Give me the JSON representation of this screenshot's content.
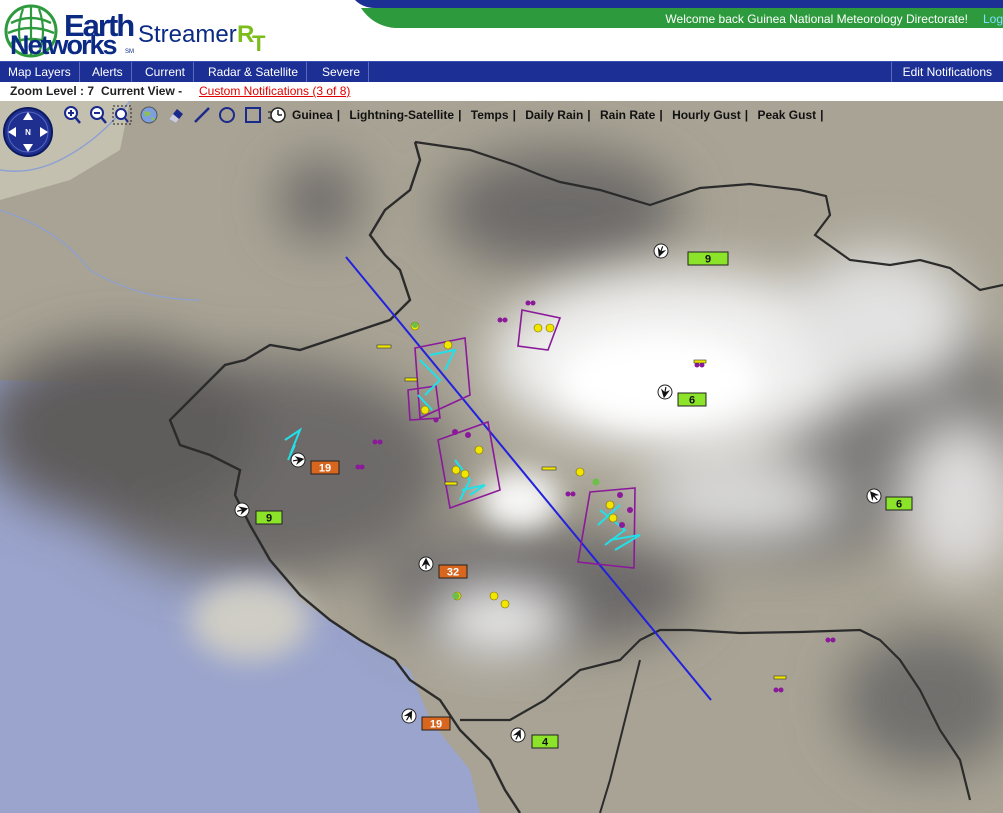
{
  "header": {
    "brand_line1": "Earth",
    "brand_line2": "Networks",
    "brand_mark": "SM",
    "product_name": "Streamer",
    "product_r": "R",
    "product_t": "T",
    "welcome_text": "Welcome back  Guinea National Meteorology Directorate!",
    "welcome_link": "Log"
  },
  "nav": {
    "items": [
      "Map Layers",
      "Alerts",
      "Current",
      "Radar & Satellite",
      "Severe"
    ],
    "right_item": "Edit Notifications"
  },
  "status": {
    "zoom_label": "Zoom Level : 7",
    "view_label": "Current View -",
    "notifications_link": "Custom Notifications (3 of 8)"
  },
  "toolbar": {
    "icons": [
      "zoom-in-icon",
      "zoom-out-icon",
      "zoom-box-icon",
      "globe-icon",
      "eraser-icon",
      "line-draw-icon",
      "circle-draw-icon",
      "square-draw-icon",
      "clock-icon"
    ]
  },
  "layers": [
    "Guinea",
    "Lightning-Satellite",
    "Temps",
    "Daily Rain",
    "Rain Rate",
    "Hourly Gust",
    "Peak Gust"
  ],
  "wind_stations": [
    {
      "value": "9",
      "color": "#8be32a"
    },
    {
      "value": "6",
      "color": "#8be32a"
    },
    {
      "value": "19",
      "color": "#d9661f"
    },
    {
      "value": "9",
      "color": "#8be32a"
    },
    {
      "value": "6",
      "color": "#8be32a"
    },
    {
      "value": "32",
      "color": "#d9661f"
    },
    {
      "value": "19",
      "color": "#d9661f"
    },
    {
      "value": "4",
      "color": "#8be32a"
    }
  ],
  "colors": {
    "nav_bg": "#1c2f95",
    "welcome_bar": "#2e9a3e",
    "notification_red": "#e00000",
    "brand_blue": "#0a2a84",
    "brand_green": "#7cbd1b",
    "storm_polygon": "#8a1a9a",
    "storm_track": "#2222dd",
    "lightning_cyan": "#22e0e8",
    "lightning_yellow": "#f2e600"
  }
}
